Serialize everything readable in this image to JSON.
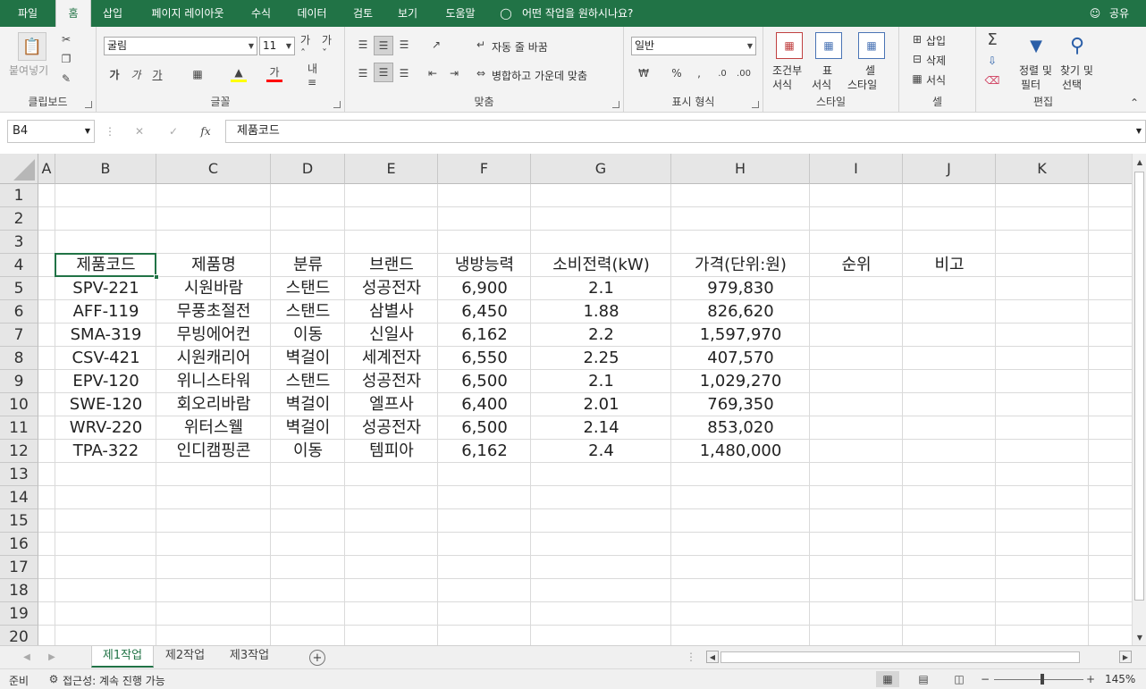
{
  "ribbon_tabs": [
    "파일",
    "홈",
    "삽입",
    "페이지 레이아웃",
    "수식",
    "데이터",
    "검토",
    "보기",
    "도움말"
  ],
  "tell_me": "어떤 작업을 원하시나요?",
  "share": "공유",
  "clipboard": {
    "paste": "붙여넣기",
    "label": "클립보드"
  },
  "font": {
    "name": "굴림",
    "size": "11",
    "label": "글꼴"
  },
  "alignment": {
    "wrap": "자동 줄 바꿈",
    "merge": "병합하고 가운데 맞춤",
    "label": "맞춤"
  },
  "number": {
    "format": "일반",
    "label": "표시 형식"
  },
  "styles": {
    "cond_line1": "조건부",
    "cond_line2": "서식",
    "table_line1": "표",
    "table_line2": "서식",
    "cell_line1": "셀",
    "cell_line2": "스타일",
    "label": "스타일"
  },
  "cells": {
    "insert": "삽입",
    "delete": "삭제",
    "format": "서식",
    "label": "셀"
  },
  "editing": {
    "sort_line1": "정렬 및",
    "sort_line2": "필터",
    "find_line1": "찾기 및",
    "find_line2": "선택",
    "label": "편집"
  },
  "formula_bar": {
    "name_box": "B4",
    "formula": "제품코드"
  },
  "columns": [
    "A",
    "B",
    "C",
    "D",
    "E",
    "F",
    "G",
    "H",
    "I",
    "J",
    "K"
  ],
  "rows": [
    "1",
    "2",
    "3",
    "4",
    "5",
    "6",
    "7",
    "8",
    "9",
    "10",
    "11",
    "12",
    "13",
    "14",
    "15",
    "16",
    "17",
    "18",
    "19",
    "20"
  ],
  "table": {
    "headers": [
      "제품코드",
      "제품명",
      "분류",
      "브랜드",
      "냉방능력",
      "소비전력(kW)",
      "가격(단위:원)",
      "순위",
      "비고"
    ],
    "rows": [
      [
        "SPV-221",
        "시원바람",
        "스탠드",
        "성공전자",
        "6,900",
        "2.1",
        "979,830",
        "",
        ""
      ],
      [
        "AFF-119",
        "무풍초절전",
        "스탠드",
        "삼별사",
        "6,450",
        "1.88",
        "826,620",
        "",
        ""
      ],
      [
        "SMA-319",
        "무빙에어컨",
        "이동",
        "신일사",
        "6,162",
        "2.2",
        "1,597,970",
        "",
        ""
      ],
      [
        "CSV-421",
        "시원캐리어",
        "벽걸이",
        "세계전자",
        "6,550",
        "2.25",
        "407,570",
        "",
        ""
      ],
      [
        "EPV-120",
        "위니스타워",
        "스탠드",
        "성공전자",
        "6,500",
        "2.1",
        "1,029,270",
        "",
        ""
      ],
      [
        "SWE-120",
        "회오리바람",
        "벽걸이",
        "엘프사",
        "6,400",
        "2.01",
        "769,350",
        "",
        ""
      ],
      [
        "WRV-220",
        "위터스웰",
        "벽걸이",
        "성공전자",
        "6,500",
        "2.14",
        "853,020",
        "",
        ""
      ],
      [
        "TPA-322",
        "인디캠핑콘",
        "이동",
        "템피아",
        "6,162",
        "2.4",
        "1,480,000",
        "",
        ""
      ]
    ]
  },
  "sheets": [
    "제1작업",
    "제2작업",
    "제3작업"
  ],
  "status": {
    "ready": "준비",
    "accessibility": "접근성: 계속 진행 가능",
    "zoom": "145%"
  },
  "colors": {
    "accent": "#217346"
  }
}
